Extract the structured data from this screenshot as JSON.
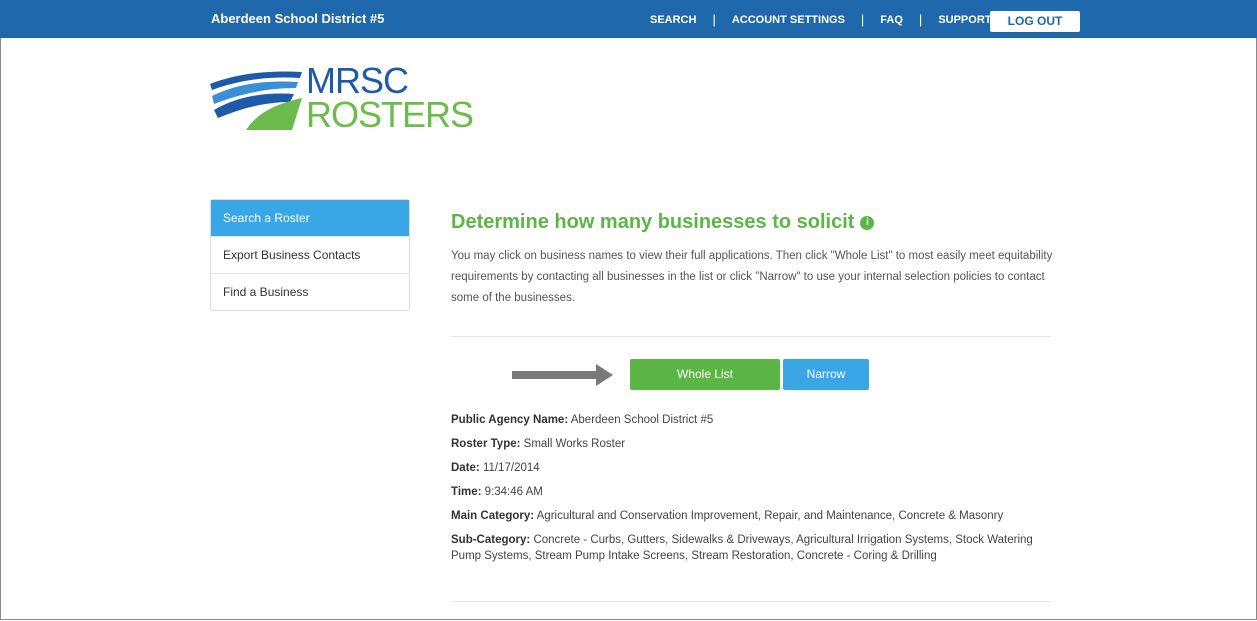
{
  "header": {
    "org_name": "Aberdeen School District #5",
    "nav": [
      "SEARCH",
      "ACCOUNT SETTINGS",
      "FAQ",
      "SUPPORT"
    ],
    "logout_label": "LOG OUT",
    "bar_color": "#1f68ac"
  },
  "logo": {
    "line1": "MRSC",
    "line2": "ROSTERS"
  },
  "sidebar": {
    "items": [
      {
        "label": "Search a Roster",
        "active": true
      },
      {
        "label": "Export Business Contacts",
        "active": false
      },
      {
        "label": "Find a Business",
        "active": false
      }
    ]
  },
  "main": {
    "title": "Determine how many businesses to solicit",
    "intro": "You may click on business names to view their full applications. Then click \"Whole List\" to most easily meet equitability requirements by contacting all businesses in the list or click \"Narrow\" to use your internal selection policies to contact some of the businesses.",
    "whole_list_label": "Whole List",
    "narrow_label": "Narrow"
  },
  "details": {
    "agency_label": "Public Agency Name:",
    "agency_value": "Aberdeen School District #5",
    "roster_label": "Roster Type:",
    "roster_value": "Small Works Roster",
    "date_label": "Date:",
    "date_value": "11/17/2014",
    "time_label": "Time:",
    "time_value": "9:34:46 AM",
    "main_cat_label": "Main Category:",
    "main_cat_value": "Agricultural and Conservation Improvement, Repair, and Maintenance, Concrete & Masonry",
    "sub_cat_label": "Sub-Category:",
    "sub_cat_value": "Concrete - Curbs, Gutters, Sidewalks & Driveways, Agricultural Irrigation Systems, Stock Watering Pump Systems, Stream Pump Intake Screens, Stream Restoration, Concrete - Coring & Drilling"
  },
  "colors": {
    "green": "#5cb646",
    "blue": "#39a6e5"
  },
  "icons": {
    "info": "info-icon",
    "arrow": "right-arrow-icon"
  }
}
